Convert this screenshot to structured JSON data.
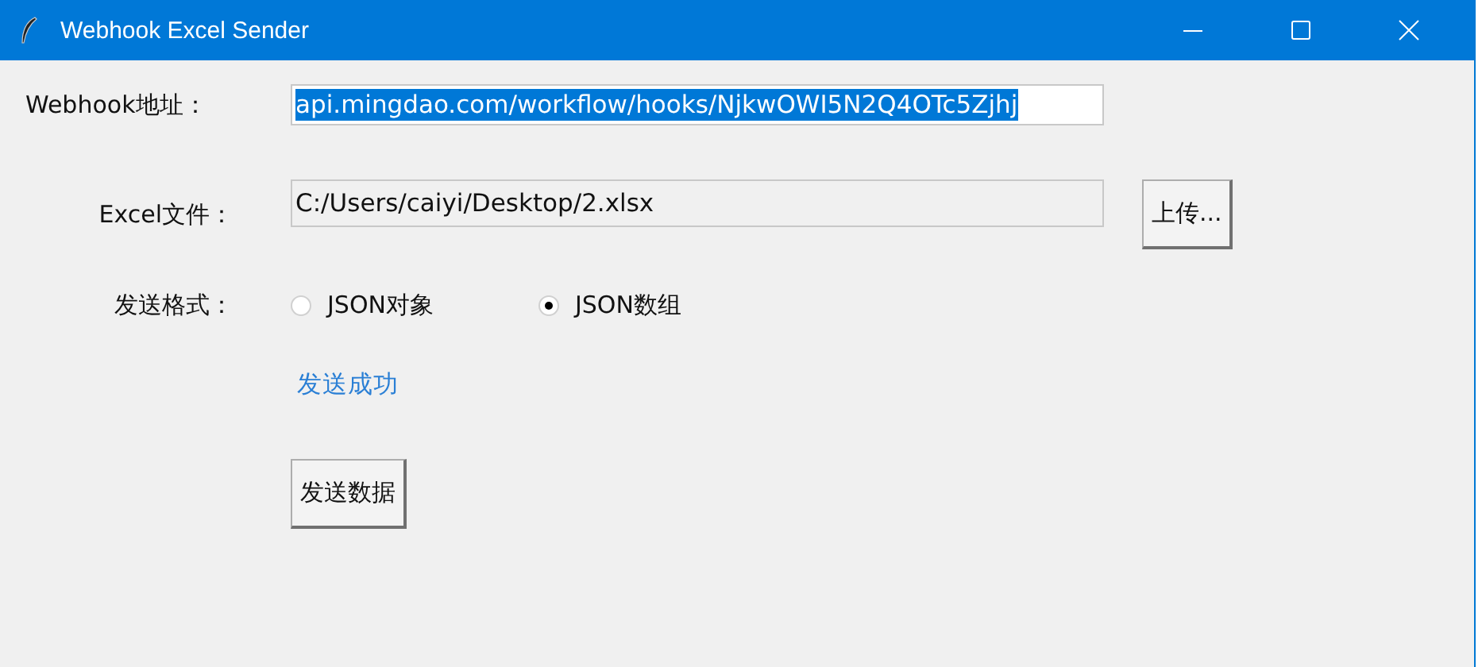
{
  "window": {
    "title": "Webhook Excel Sender"
  },
  "webhook": {
    "label": "Webhook地址：",
    "value": "api.mingdao.com/workflow/hooks/NjkwOWI5N2Q4OTc5Zjhj",
    "text_selected": true
  },
  "excel": {
    "label": "Excel文件：",
    "value": "C:/Users/caiyi/Desktop/2.xlsx",
    "button": "上传..."
  },
  "format": {
    "label": "发送格式：",
    "options": [
      {
        "label": "JSON对象",
        "selected": false
      },
      {
        "label": "JSON数组",
        "selected": true
      }
    ]
  },
  "status": "发送成功",
  "send_button": "发送数据"
}
